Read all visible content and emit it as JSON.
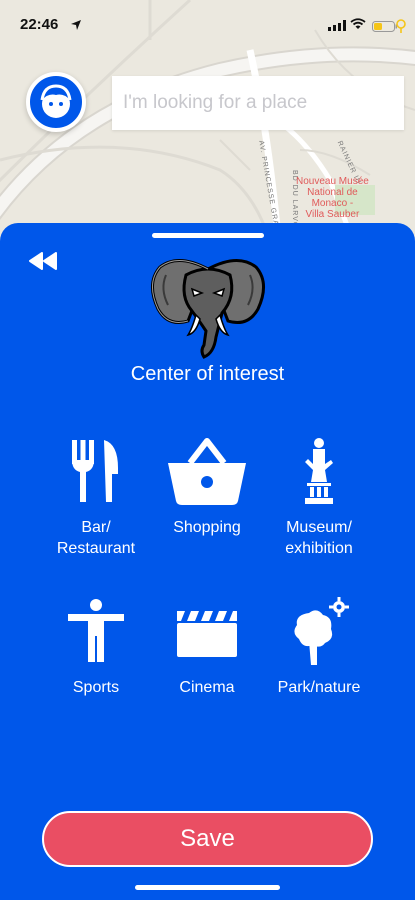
{
  "status_bar": {
    "time": "22:46"
  },
  "map": {
    "poi_label": "Nouveau Musée\nNational de\nMonaco -\nVilla Sauber",
    "road_labels": [
      "AV. PRINCESSE GRACE",
      "BD DU LARVOTTO",
      "RAINIER III"
    ]
  },
  "search": {
    "placeholder": "I'm looking for a place"
  },
  "sheet": {
    "title": "Center of interest",
    "categories": [
      {
        "label": "Bar/\nRestaurant",
        "icon": "fork-knife-icon"
      },
      {
        "label": "Shopping",
        "icon": "basket-icon"
      },
      {
        "label": "Museum/\nexhibition",
        "icon": "statue-icon"
      },
      {
        "label": "Sports",
        "icon": "person-icon"
      },
      {
        "label": "Cinema",
        "icon": "clapperboard-icon"
      },
      {
        "label": "Park/nature",
        "icon": "tree-icon"
      }
    ],
    "save_label": "Save"
  },
  "colors": {
    "sheet_background": "#0057ea",
    "save_button": "#ea4e63",
    "map_background": "#ebe8df"
  }
}
